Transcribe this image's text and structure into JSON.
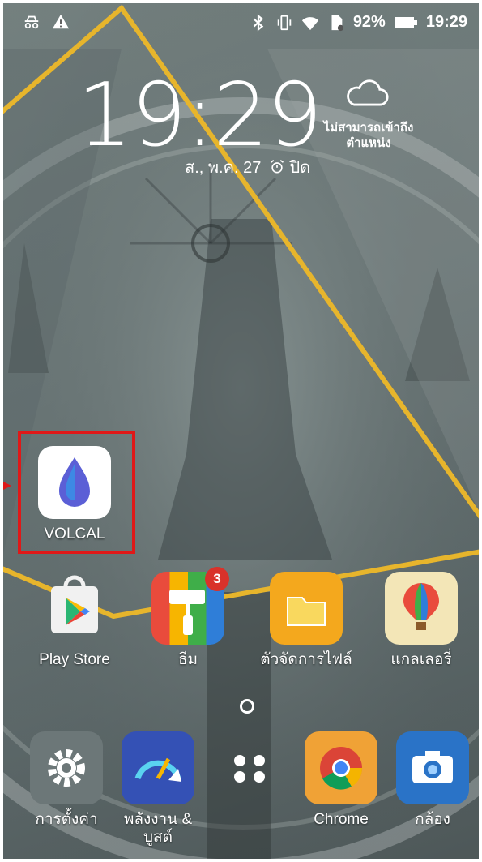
{
  "status_bar": {
    "left_icons": [
      "incognito-icon",
      "warning-icon"
    ],
    "right_icons": [
      "bluetooth-icon",
      "vibrate-icon",
      "wifi-icon",
      "sd-card-icon",
      "battery-icon"
    ],
    "battery": "92%",
    "time": "19:29"
  },
  "lock_clock": {
    "time": "19:29",
    "date": "ส., พ.ค. 27",
    "alarm": "ปิด"
  },
  "weather": {
    "icon": "cloud-icon",
    "line1": "ไม่สามารถเข้าถึง",
    "line2": "ตำแหน่ง"
  },
  "highlighted_app": {
    "label": "VOLCAL",
    "icon": "volcal-drop-icon"
  },
  "row_apps": [
    {
      "label": "Play Store",
      "icon": "play-store-icon"
    },
    {
      "label": "ธีม",
      "icon": "theme-icon",
      "badge": "3"
    },
    {
      "label": "ตัวจัดการไฟล์",
      "icon": "file-manager-icon"
    },
    {
      "label": "แกลเลอรี่",
      "icon": "gallery-icon"
    }
  ],
  "dock": [
    {
      "label": "การตั้งค่า",
      "icon": "settings-icon"
    },
    {
      "label": "พลังงาน &",
      "label2": "บูสต์",
      "icon": "power-boost-icon"
    },
    {
      "label": "",
      "icon": "app-drawer-icon"
    },
    {
      "label": "Chrome",
      "icon": "chrome-icon"
    },
    {
      "label": "กล้อง",
      "icon": "camera-icon"
    }
  ],
  "colors": {
    "highlight": "#e01818",
    "gold_line": "#e7b52c",
    "badge": "#d9322a"
  }
}
